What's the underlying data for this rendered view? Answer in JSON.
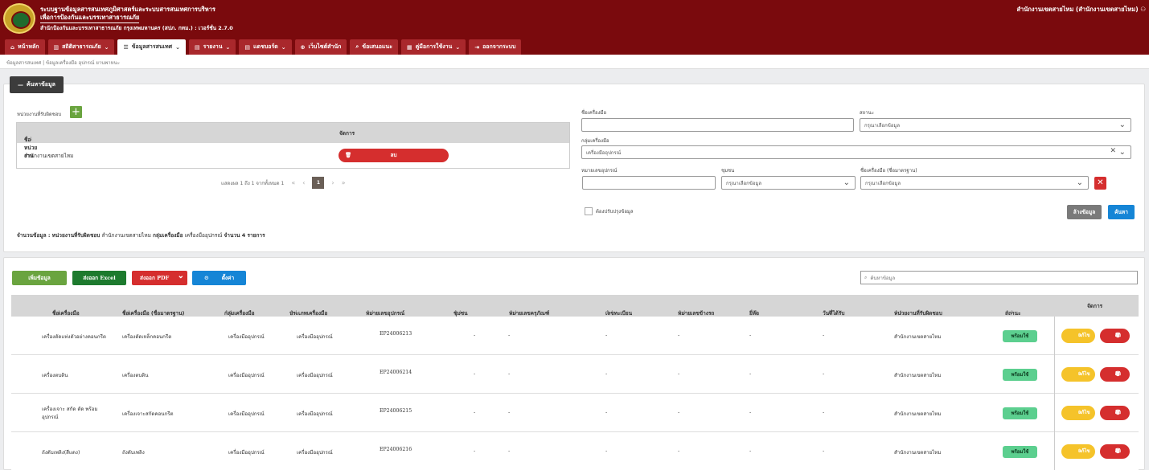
{
  "header": {
    "title_line1": "ระบบฐานข้อมูลสารสนเทศภูมิศาสตร์และระบบสารสนเทศการบริหาร",
    "title_line2": "เพื่อการป้องกันและบรรเทาสาธารณภัย",
    "org_line": "สำนักป้องกันและบรรเทาสาธารณภัย กรุงเทพมหานคร (สปภ. กทม.) : เวอร์ชั่น 2.7.0",
    "user": "สำนักงานเขตสายไหม (สำนักงานเขตสายไหม)"
  },
  "nav": [
    {
      "label": "หน้าหลัก",
      "icon": "⌂",
      "caret": ""
    },
    {
      "label": "สถิติสาธารณภัย",
      "icon": "▥",
      "caret": "⌄"
    },
    {
      "label": "ข้อมูลสารสนเทศ",
      "icon": "☰",
      "caret": "⌄"
    },
    {
      "label": "รายงาน",
      "icon": "▤",
      "caret": "⌄"
    },
    {
      "label": "แดชบอร์ด",
      "icon": "▤",
      "caret": "⌄"
    },
    {
      "label": "เว็บไซต์สำนัก",
      "icon": "⊕",
      "caret": ""
    },
    {
      "label": "ข้อเสนอแนะ",
      "icon": "⌕",
      "caret": ""
    },
    {
      "label": "คู่มือการใช้งาน",
      "icon": "▦",
      "caret": "⌄"
    },
    {
      "label": "ออกจากระบบ",
      "icon": "⇥",
      "caret": ""
    }
  ],
  "breadcrumb": "ข้อมูลสารสนเทศ | ข้อมูลเครื่องมือ อุปกรณ์ ยานพาหนะ",
  "search_panel": {
    "tag": "ค้นหาข้อมูล",
    "agency_label": "หน่วยงานที่รับผิดชอบ",
    "agency_table": {
      "col_name": "ชื่อหน่วยงาน",
      "col_manage": "จัดการ",
      "rows": [
        {
          "name": "สำนักงานเขตสายไหม",
          "delete": "ลบ"
        }
      ]
    },
    "pager": {
      "info": "แสดงผล 1 ถึง 1 จากทั้งหมด 1",
      "current": "1"
    },
    "tool_name_label": "ชื่อเครื่องมือ",
    "status_label": "สถานะ",
    "status_placeholder": "กรุณาเลือกข้อมูล",
    "group_label": "กลุ่มเครื่องมือ",
    "group_value": "เครื่องมืออุปกรณ์",
    "equip_no_label": "หมายเลขอุปกรณ์",
    "type_label": "ชุมชน",
    "type_placeholder": "กรุณาเลือกข้อมูล",
    "std_label": "ชื่อเครื่องมือ (ชื่อมาตรฐาน)",
    "std_placeholder": "กรุณาเลือกข้อมูล",
    "repair_label": "ต้องปรับปรุงข้อมูล",
    "clear_btn": "ล้างข้อมูล",
    "search_btn": "ค้นหา",
    "summary_label": "จำนวนข้อมูล :",
    "summary_agency_label": "หน่วยงานที่รับผิดชอบ",
    "summary_agency": "สำนักงานเขตสายไหม",
    "summary_group_label": "กลุ่มเครื่องมือ",
    "summary_group": "เครื่องมืออุปกรณ์",
    "summary_count": "จำนวน 4 รายการ"
  },
  "toolbar": {
    "add": "เพิ่มข้อมูล",
    "excel": "ส่งออก Excel",
    "pdf": "ส่งออก PDF",
    "settings": "ตั้งค่า",
    "search_placeholder": "ค้นหาข้อมูล"
  },
  "table": {
    "headers": [
      "ชื่อเครื่องมือ",
      "ชื่อเครื่องมือ (ชื่อมาตรฐาน)",
      "กลุ่มเครื่องมือ",
      "ประเภทเครื่องมือ",
      "หมายเลขอุปกรณ์",
      "ชุมชน",
      "หมายเลขครุภัณฑ์",
      "เลขทะเบียน",
      "หมายเลขข้างรถ",
      "ยี่ห้อ",
      "วันที่ได้รับ",
      "หน่วยงานที่รับผิดชอบ",
      "สถานะ",
      "จัดการ"
    ],
    "rows": [
      {
        "name": "เครื่องตัดแท่งตัวอย่างคอนกรีต",
        "std": "เครื่องตัดเหล็กคอนกรีต",
        "group": "เครื่องมืออุปกรณ์",
        "type": "เครื่องมืออุปกรณ์",
        "no": "EP24006213",
        "comm": "-",
        "asset": "-",
        "reg": "-",
        "side": "-",
        "brand": "-",
        "date": "-",
        "agency": "สำนักงานเขตสายไหม",
        "status": "พร้อมใช้",
        "edit": "แก้ไข",
        "del": "ลบ"
      },
      {
        "name": "เครื่องตบดิน",
        "std": "เครื่องตบดิน",
        "group": "เครื่องมืออุปกรณ์",
        "type": "เครื่องมืออุปกรณ์",
        "no": "EP24006214",
        "comm": "-",
        "asset": "-",
        "reg": "-",
        "side": "-",
        "brand": "-",
        "date": "-",
        "agency": "สำนักงานเขตสายไหม",
        "status": "พร้อมใช้",
        "edit": "แก้ไข",
        "del": "ลบ"
      },
      {
        "name": "เครื่องเจาะ สกัด ตัด พร้อม",
        "name2": "อุปกรณ์",
        "std": "เครื่องเจาะสกัดคอนกรีต",
        "group": "เครื่องมืออุปกรณ์",
        "type": "เครื่องมืออุปกรณ์",
        "no": "EP24006215",
        "comm": "-",
        "asset": "-",
        "reg": "-",
        "side": "-",
        "brand": "-",
        "date": "-",
        "agency": "สำนักงานเขตสายไหม",
        "status": "พร้อมใช้",
        "edit": "แก้ไข",
        "del": "ลบ"
      },
      {
        "name": "ถังดับเพลิง(สีแดง)",
        "std": "ถังดับเพลิง",
        "group": "เครื่องมืออุปกรณ์",
        "type": "เครื่องมืออุปกรณ์",
        "no": "EP24006216",
        "comm": "-",
        "asset": "-",
        "reg": "-",
        "side": "-",
        "brand": "-",
        "date": "-",
        "agency": "สำนักงานเขตสายไหม",
        "status": "พร้อมใช้",
        "edit": "แก้ไข",
        "del": "ลบ"
      }
    ]
  }
}
